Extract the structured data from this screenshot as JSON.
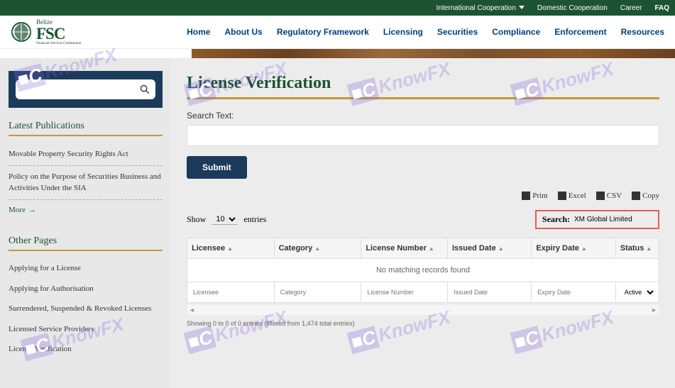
{
  "topbar": {
    "international": "International Cooperation",
    "domestic": "Domestic Cooperation",
    "career": "Career",
    "faq": "FAQ"
  },
  "logo": {
    "top": "Belize",
    "main": "FSC",
    "sub": "Financial Services Commission"
  },
  "nav": [
    "Home",
    "About Us",
    "Regulatory Framework",
    "Licensing",
    "Securities",
    "Compliance",
    "Enforcement",
    "Resources"
  ],
  "sidebar": {
    "publications_title": "Latest Publications",
    "publications": [
      "Movable Property Security Rights Act",
      "Policy on the Purpose of Securities Business and Activities Under the SIA"
    ],
    "more": "More",
    "other_title": "Other Pages",
    "other": [
      "Applying for a License",
      "Applying for Authorisation",
      "Surrendered, Suspended & Revoked Licenses",
      "Licensed Service Providers",
      "License Verification"
    ]
  },
  "main": {
    "title": "License Verification",
    "search_label": "Search Text:",
    "submit": "Submit",
    "export": {
      "print": "Print",
      "excel": "Excel",
      "csv": "CSV",
      "copy": "Copy"
    },
    "show": "Show",
    "entries_count": "10",
    "entries": "entries",
    "search_label2": "Search:",
    "search_value": "XM Global Limited",
    "columns": [
      "Licensee",
      "Category",
      "License Number",
      "Issued Date",
      "Expiry Date",
      "Status"
    ],
    "no_records": "No matching records found",
    "filters": {
      "licensee": "Licensee",
      "category": "Category",
      "license_number": "License Number",
      "issued_date": "Issued Date",
      "expiry_date": "Expiry Date",
      "status": "Active"
    },
    "info": "Showing 0 to 0 of 0 entries (filtered from 1,474 total entries)"
  },
  "watermark": "KnowFX"
}
